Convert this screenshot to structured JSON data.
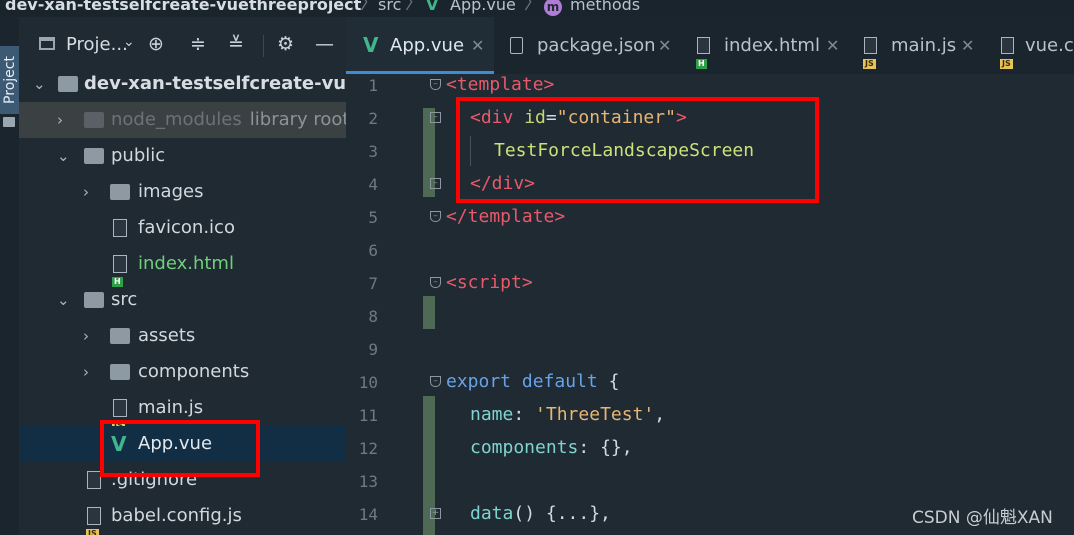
{
  "breadcrumb": {
    "project": "dev-xan-testselfcreate-vuethreeproject",
    "folder": "src",
    "file": "App.vue",
    "symbol_badge": "m",
    "symbol": "methods"
  },
  "tool_window": {
    "tab_label": "Project"
  },
  "project_panel": {
    "title": "Proje...",
    "toolbar_icons": [
      "locate-icon",
      "expand-all-icon",
      "collapse-all-icon",
      "settings-icon",
      "hide-icon"
    ]
  },
  "tree": [
    {
      "label": "dev-xan-testselfcreate-vuethreeproject",
      "kind": "folder",
      "state": "open"
    },
    {
      "label": "node_modules",
      "suffix": "library root",
      "kind": "folder",
      "state": "closed"
    },
    {
      "label": "public",
      "kind": "folder",
      "state": "open"
    },
    {
      "label": "images",
      "kind": "folder",
      "state": "closed"
    },
    {
      "label": "favicon.ico",
      "kind": "file"
    },
    {
      "label": "index.html",
      "kind": "html-file"
    },
    {
      "label": "src",
      "kind": "folder",
      "state": "open"
    },
    {
      "label": "assets",
      "kind": "folder",
      "state": "closed"
    },
    {
      "label": "components",
      "kind": "folder",
      "state": "closed"
    },
    {
      "label": "main.js",
      "kind": "js-file"
    },
    {
      "label": "App.vue",
      "kind": "vue-file",
      "selected": true
    },
    {
      "label": ".gitignore",
      "kind": "file"
    },
    {
      "label": "babel.config.js",
      "kind": "js-file"
    }
  ],
  "tabs": [
    {
      "label": "App.vue",
      "icon": "vue-icon",
      "active": true
    },
    {
      "label": "package.json",
      "icon": "json-icon"
    },
    {
      "label": "index.html",
      "icon": "html-icon"
    },
    {
      "label": "main.js",
      "icon": "js-icon"
    },
    {
      "label": "vue.config.js",
      "icon": "js-icon"
    }
  ],
  "close_glyph": "✕",
  "badges": {
    "js": "JS",
    "html": "H"
  },
  "code": {
    "line_numbers": [
      "1",
      "2",
      "3",
      "4",
      "5",
      "6",
      "7",
      "8",
      "9",
      "10",
      "11",
      "12",
      "13",
      "14"
    ],
    "template_open": "<template>",
    "div_tag_open": "<div",
    "div_attr": "id",
    "div_eq": "=",
    "div_attr_value": "\"container\"",
    "div_tag_close": ">",
    "div_text": "TestForceLandscapeScreen",
    "div_end": "</div>",
    "template_close": "</template>",
    "script_open": "<script>",
    "kw_export": "export",
    "kw_default": "default",
    "brace_open": "{",
    "name_key": "name",
    "name_value": "'ThreeTest'",
    "components_key": "components",
    "components_value": "{},",
    "data_key": "data",
    "data_value": "() {...},",
    "colon": ":",
    "comma": ","
  },
  "watermark": "CSDN @仙魁XAN",
  "colors": {
    "highlight": "#ff0000",
    "tag": "#e85a6a",
    "string": "#e8b674",
    "keyword": "#6aa2e8",
    "property": "#7fd4d0",
    "active_tab_underline": "#3c8dd4"
  }
}
